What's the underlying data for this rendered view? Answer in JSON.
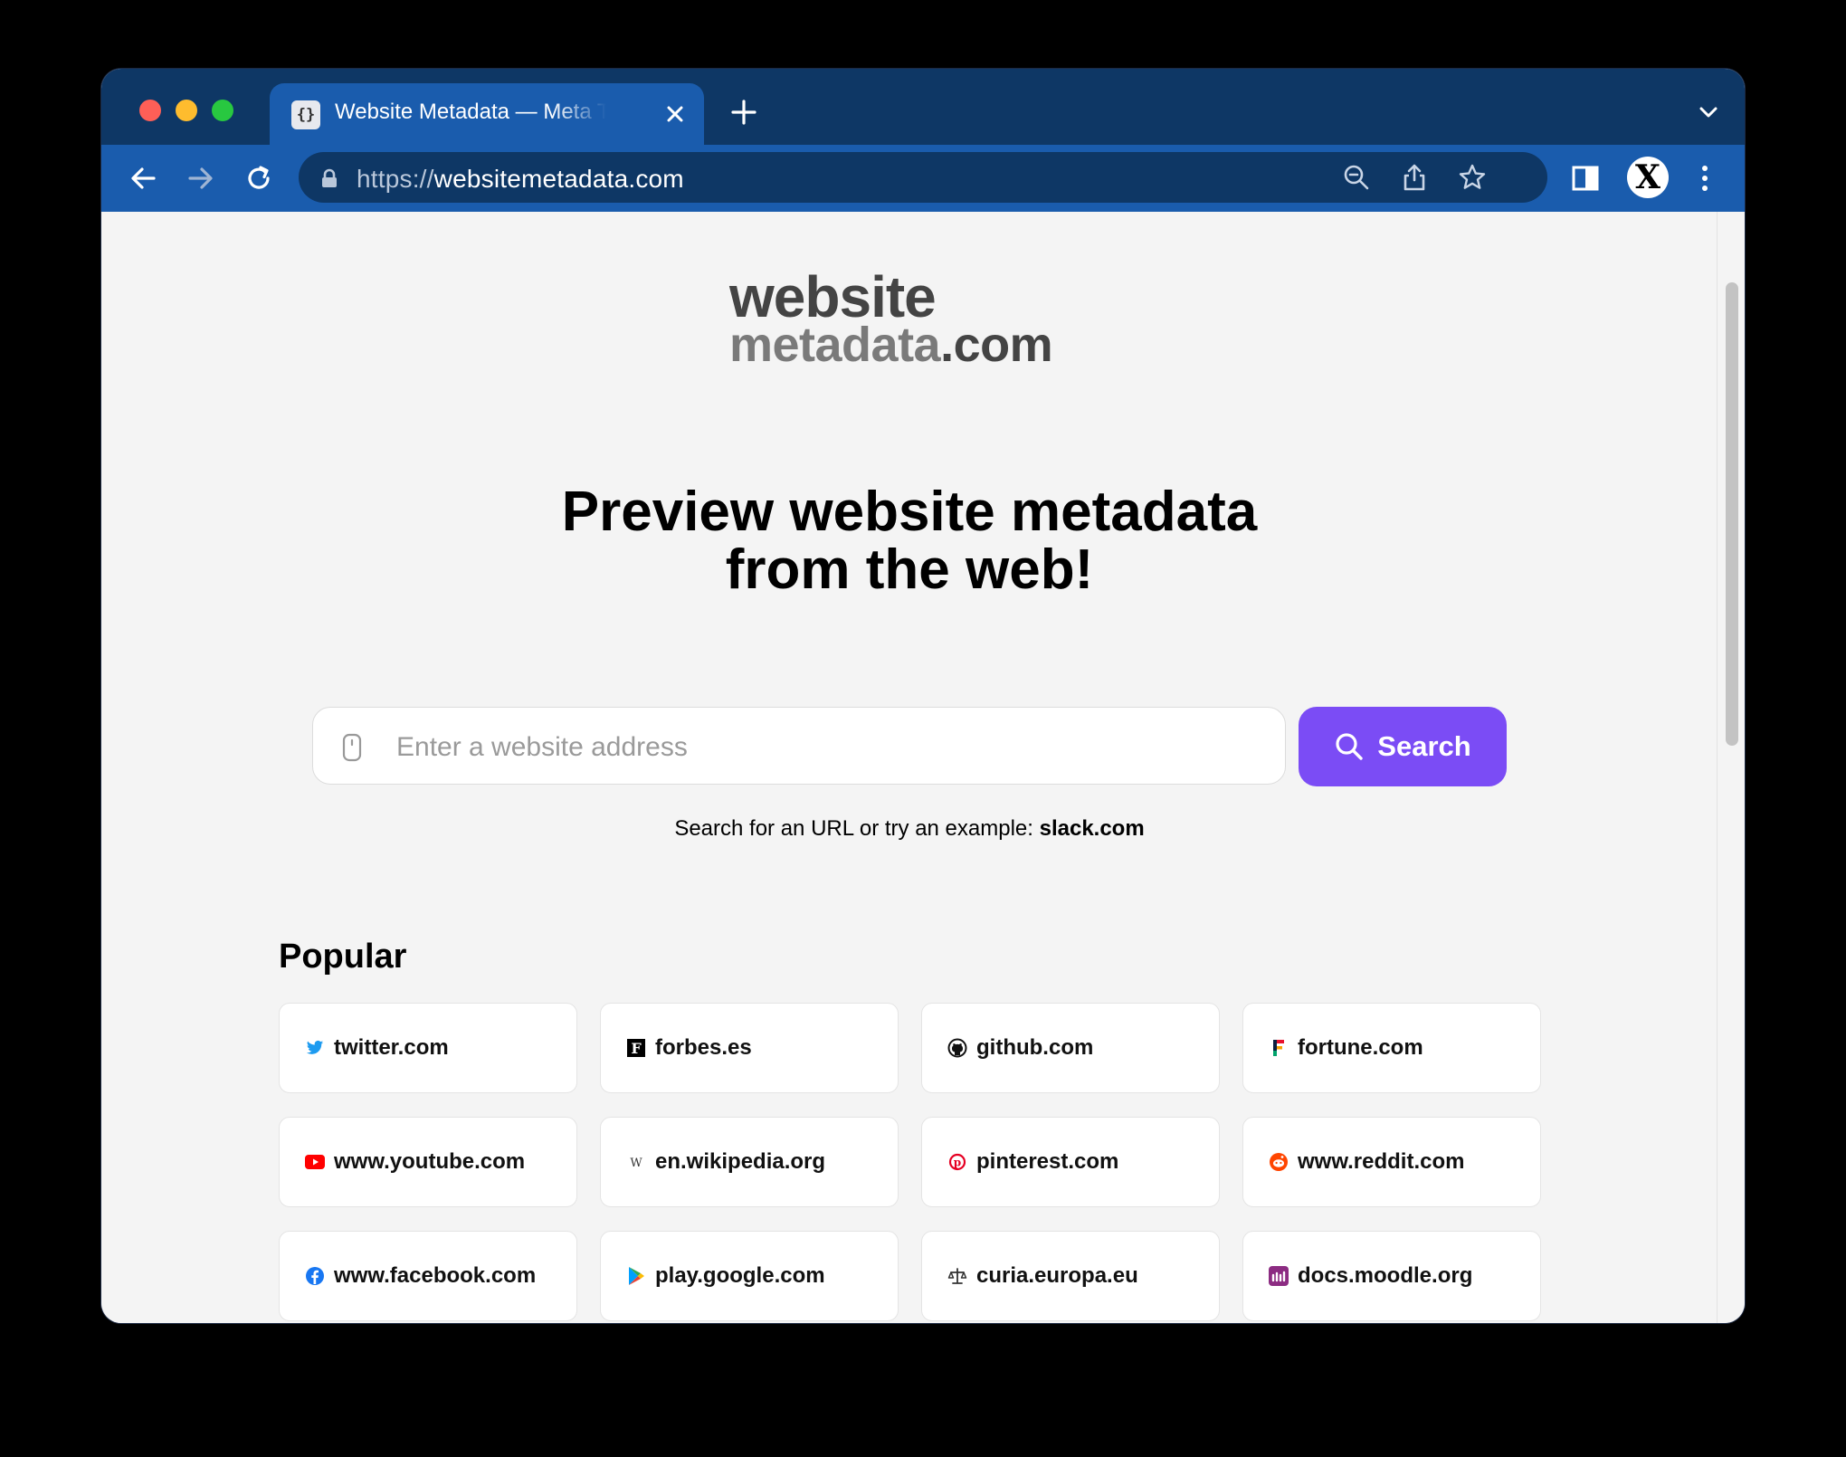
{
  "browser": {
    "tab": {
      "title": "Website Metadata — Meta Tags",
      "favicon_text": "{}"
    },
    "address": {
      "scheme": "https://",
      "host": "websitemetadata.com"
    },
    "profile_initial": "X"
  },
  "page": {
    "logo": {
      "line1": "website",
      "line2": "metadata",
      "line2_suffix": ".com"
    },
    "headline": {
      "line1": "Preview website metadata",
      "line2": "from the web!"
    },
    "search": {
      "placeholder": "Enter a website address",
      "button_label": "Search",
      "hint_prefix": "Search for an URL or try an example: ",
      "hint_example": "slack.com"
    },
    "popular": {
      "title": "Popular",
      "items": [
        {
          "label": "twitter.com",
          "icon": "twitter-icon",
          "color": "#1d9bf0"
        },
        {
          "label": "forbes.es",
          "icon": "forbes-icon",
          "color": "#000000"
        },
        {
          "label": "github.com",
          "icon": "github-icon",
          "color": "#111111"
        },
        {
          "label": "fortune.com",
          "icon": "fortune-icon",
          "color": "#0b1e3f"
        },
        {
          "label": "www.youtube.com",
          "icon": "youtube-icon",
          "color": "#ff0000"
        },
        {
          "label": "en.wikipedia.org",
          "icon": "wikipedia-icon",
          "color": "#333333"
        },
        {
          "label": "pinterest.com",
          "icon": "pinterest-icon",
          "color": "#e60023"
        },
        {
          "label": "www.reddit.com",
          "icon": "reddit-icon",
          "color": "#ff4500"
        },
        {
          "label": "www.facebook.com",
          "icon": "facebook-icon",
          "color": "#1877f2"
        },
        {
          "label": "play.google.com",
          "icon": "google-play-icon",
          "color": "#34a853"
        },
        {
          "label": "curia.europa.eu",
          "icon": "scales-icon",
          "color": "#333333"
        },
        {
          "label": "docs.moodle.org",
          "icon": "moodle-icon",
          "color": "#8c2c82"
        }
      ]
    }
  },
  "colors": {
    "accent": "#7b4cf5",
    "tab_strip": "#0e3765",
    "toolbar": "#1a5cad"
  }
}
